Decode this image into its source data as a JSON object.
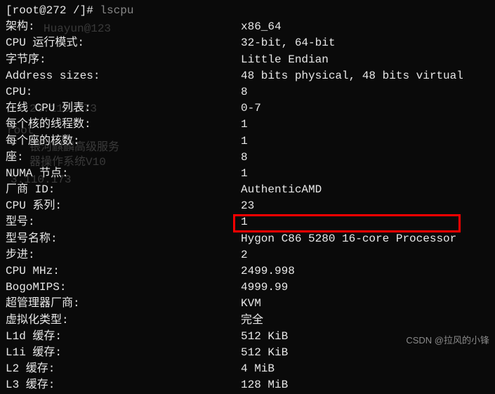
{
  "prompt": "[root@272 /]# ",
  "command": "lscpu",
  "ghosts": {
    "g1": "Huayun@123",
    "g2": "23.110.173",
    "g3": "root",
    "g4": "银河麒麟高级服务",
    "g5": "器操作系统V10",
    "g6": "3.110.173"
  },
  "rows": [
    {
      "label": "架构:",
      "value": "x86_64"
    },
    {
      "label": "CPU 运行模式:",
      "value": "32-bit, 64-bit"
    },
    {
      "label": "字节序:",
      "value": "Little Endian"
    },
    {
      "label": "Address sizes:",
      "value": "48 bits physical, 48 bits virtual"
    },
    {
      "label": "CPU:",
      "value": "8"
    },
    {
      "label": "在线 CPU 列表:",
      "value": "0-7"
    },
    {
      "label": "每个核的线程数:",
      "value": "1"
    },
    {
      "label": "每个座的核数:",
      "value": "1"
    },
    {
      "label": "座:",
      "value": "8"
    },
    {
      "label": "NUMA 节点:",
      "value": "1"
    },
    {
      "label": "厂商 ID:",
      "value": "AuthenticAMD"
    },
    {
      "label": "CPU 系列:",
      "value": "23"
    },
    {
      "label": "型号:",
      "value": "1"
    },
    {
      "label": "型号名称:",
      "value": "Hygon C86 5280 16-core Processor"
    },
    {
      "label": "步进:",
      "value": "2"
    },
    {
      "label": "CPU MHz:",
      "value": "2499.998"
    },
    {
      "label": "BogoMIPS:",
      "value": "4999.99"
    },
    {
      "label": "超管理器厂商:",
      "value": "KVM"
    },
    {
      "label": "虚拟化类型:",
      "value": "完全"
    },
    {
      "label": "L1d 缓存:",
      "value": "512 KiB"
    },
    {
      "label": "L1i 缓存:",
      "value": "512 KiB"
    },
    {
      "label": "L2 缓存:",
      "value": "4 MiB"
    },
    {
      "label": "L3 缓存:",
      "value": "128 MiB"
    }
  ],
  "watermark": "CSDN @拉风的小锋"
}
